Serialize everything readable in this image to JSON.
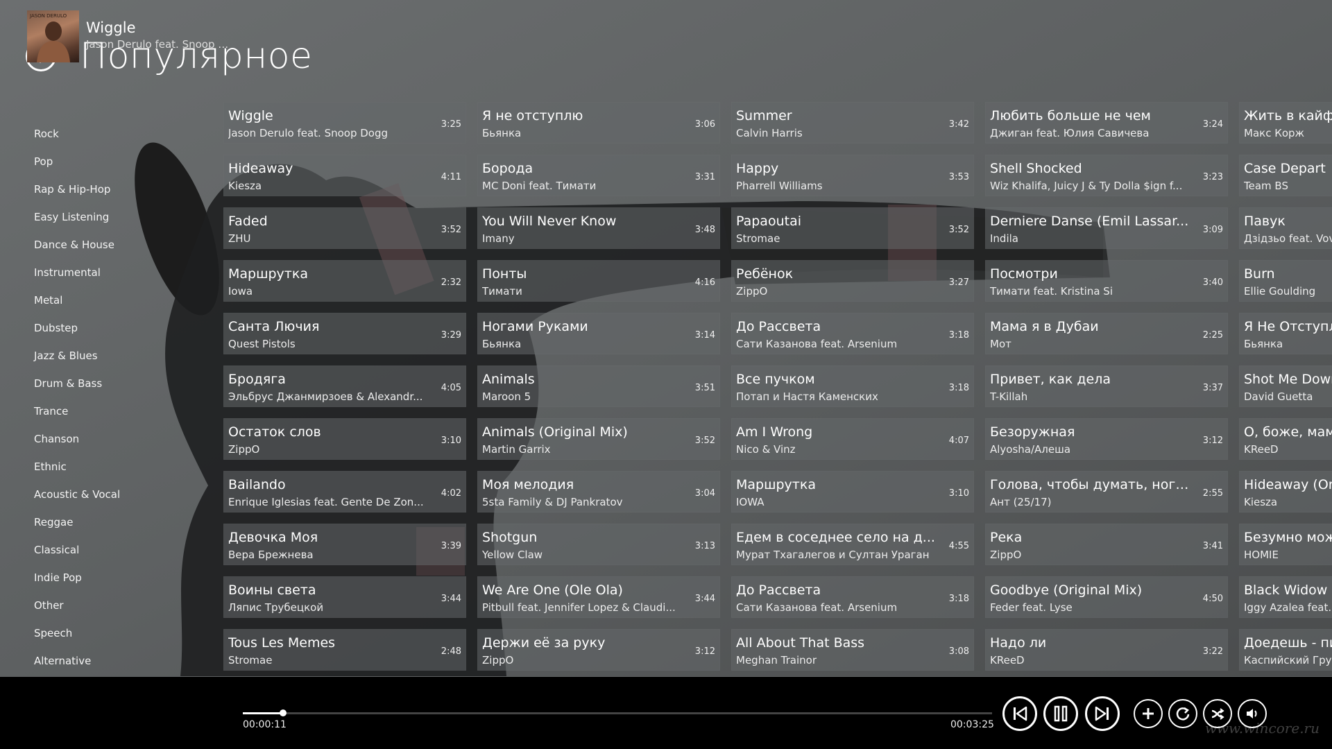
{
  "header": {
    "title": "Популярное"
  },
  "genres": [
    "Rock",
    "Pop",
    "Rap & Hip-Hop",
    "Easy Listening",
    "Dance & House",
    "Instrumental",
    "Metal",
    "Dubstep",
    "Jazz & Blues",
    "Drum & Bass",
    "Trance",
    "Chanson",
    "Ethnic",
    "Acoustic & Vocal",
    "Reggae",
    "Classical",
    "Indie Pop",
    "Other",
    "Speech",
    "Alternative"
  ],
  "tracks": [
    {
      "title": "Wiggle",
      "artist": "Jason Derulo feat. Snoop Dogg",
      "duration": "3:25"
    },
    {
      "title": "Hideaway",
      "artist": "Kiesza",
      "duration": "4:11"
    },
    {
      "title": "Faded",
      "artist": "ZHU",
      "duration": "3:52"
    },
    {
      "title": "Маршрутка",
      "artist": "Iowa",
      "duration": "2:32"
    },
    {
      "title": "Санта Лючия",
      "artist": "Quest Pistols",
      "duration": "3:29"
    },
    {
      "title": "Бродяга",
      "artist": "Эльбрус Джанмирзоев & Alexandr...",
      "duration": "4:05"
    },
    {
      "title": "Остаток слов",
      "artist": "ZippO",
      "duration": "3:10"
    },
    {
      "title": "Bailando",
      "artist": "Enrique Iglesias feat. Gente De Zon...",
      "duration": "4:02"
    },
    {
      "title": "Девочка Моя",
      "artist": "Вера Брежнева",
      "duration": "3:39"
    },
    {
      "title": "Воины света",
      "artist": "Ляпис Трубецкой",
      "duration": "3:44"
    },
    {
      "title": "Tous Les Memes",
      "artist": "Stromae",
      "duration": "2:48"
    },
    {
      "title": "Я не отступлю",
      "artist": "Бьянка",
      "duration": "3:06"
    },
    {
      "title": "Борода",
      "artist": "MC Doni feat. Тимати",
      "duration": "3:31"
    },
    {
      "title": "You Will Never Know",
      "artist": "Imany",
      "duration": "3:48"
    },
    {
      "title": "Понты",
      "artist": "Тимати",
      "duration": "4:16"
    },
    {
      "title": "Ногами Руками",
      "artist": "Бьянка",
      "duration": "3:14"
    },
    {
      "title": "Animals",
      "artist": "Maroon 5",
      "duration": "3:51"
    },
    {
      "title": "Animals (Original Mix)",
      "artist": "Martin Garrix",
      "duration": "3:52"
    },
    {
      "title": "Моя мелодия",
      "artist": "5sta Family & DJ Pankratov",
      "duration": "3:04"
    },
    {
      "title": "Shotgun",
      "artist": "Yellow Claw",
      "duration": "3:13"
    },
    {
      "title": "We Are One (Ole Ola)",
      "artist": "Pitbull feat. Jennifer Lopez & Claudi...",
      "duration": "3:44"
    },
    {
      "title": "Держи её за руку",
      "artist": "ZippO",
      "duration": "3:12"
    },
    {
      "title": "Summer",
      "artist": "Calvin Harris",
      "duration": "3:42"
    },
    {
      "title": "Happy",
      "artist": "Pharrell Williams",
      "duration": "3:53"
    },
    {
      "title": " Papaoutai",
      "artist": "Stromae",
      "duration": "3:52"
    },
    {
      "title": "Ребёнок",
      "artist": "ZippO",
      "duration": "3:27"
    },
    {
      "title": "До Рассвета",
      "artist": "Сати Казанова feat. Arsenium",
      "duration": "3:18"
    },
    {
      "title": "Все пучком",
      "artist": "Потап и Настя Каменских",
      "duration": "3:18"
    },
    {
      "title": "Am I Wrong",
      "artist": "Nico & Vinz",
      "duration": "4:07"
    },
    {
      "title": "Маршрутка",
      "artist": "IOWA",
      "duration": "3:10"
    },
    {
      "title": "Едем в соседнее село на д...",
      "artist": "Мурат Тхагалегов и Султан Ураган",
      "duration": "4:55"
    },
    {
      "title": "До Рассвета",
      "artist": "Сати Казанова feat. Arsenium",
      "duration": "3:18"
    },
    {
      "title": "All About That Bass",
      "artist": "Meghan Trainor",
      "duration": "3:08"
    },
    {
      "title": "Любить больше не чем",
      "artist": "Джиган feat. Юлия Савичева",
      "duration": "3:24"
    },
    {
      "title": "Shell Shocked",
      "artist": "Wiz Khalifa, Juicy J & Ty Dolla $ign f...",
      "duration": "3:23"
    },
    {
      "title": " Derniere Danse (Emil Lassar...",
      "artist": "Indila",
      "duration": "3:09"
    },
    {
      "title": "Посмотри",
      "artist": "Тимати feat. Kristina Si",
      "duration": "3:40"
    },
    {
      "title": "Мама я в Дубаи",
      "artist": "Мот",
      "duration": "2:25"
    },
    {
      "title": "Привет, как дела",
      "artist": "T-Killah",
      "duration": "3:37"
    },
    {
      "title": "Безоружная",
      "artist": "Alyosha/Алеша",
      "duration": "3:12"
    },
    {
      "title": "Голова, чтобы думать, ноги...",
      "artist": "Ант (25/17)",
      "duration": "2:55"
    },
    {
      "title": "Река",
      "artist": "ZippO",
      "duration": "3:41"
    },
    {
      "title": "Goodbye  (Original Mix)",
      "artist": "Feder feat. Lyse",
      "duration": "4:50"
    },
    {
      "title": "Надо ли",
      "artist": "KReeD",
      "duration": "3:22"
    },
    {
      "title": "Жить в кайф",
      "artist": "Макс Корж",
      "duration": ""
    },
    {
      "title": "Case Depart",
      "artist": "Team BS",
      "duration": ""
    },
    {
      "title": "Павук",
      "artist": "Дзідзьо feat. Vova",
      "duration": ""
    },
    {
      "title": "Burn",
      "artist": "Ellie Goulding",
      "duration": ""
    },
    {
      "title": "Я Не Отступлю",
      "artist": "Бьянка",
      "duration": ""
    },
    {
      "title": "Shot Me Down",
      "artist": "David Guetta",
      "duration": ""
    },
    {
      "title": "О, боже, мама",
      "artist": " KReeD",
      "duration": ""
    },
    {
      "title": "Hideaway (Original",
      "artist": "Kiesza",
      "duration": ""
    },
    {
      "title": "Безумно можно",
      "artist": "HOMIE",
      "duration": ""
    },
    {
      "title": "Black Widow",
      "artist": "Iggy Azalea feat. R",
      "duration": ""
    },
    {
      "title": "Доедешь - пиши",
      "artist": "Каспийский Груз",
      "duration": ""
    }
  ],
  "player": {
    "title": "Wiggle",
    "artist": "Jason Derulo feat. Snoop Do...",
    "elapsed": "00:00:11",
    "total": "00:03:25",
    "progress": 0.0537
  },
  "album_art": {
    "text": "JASON DERULO"
  },
  "watermark": "www.wincore.ru",
  "colors": {
    "background": "#5f6263",
    "tile": "#64686a",
    "player_bar": "#000000",
    "foreground": "#ffffff"
  }
}
